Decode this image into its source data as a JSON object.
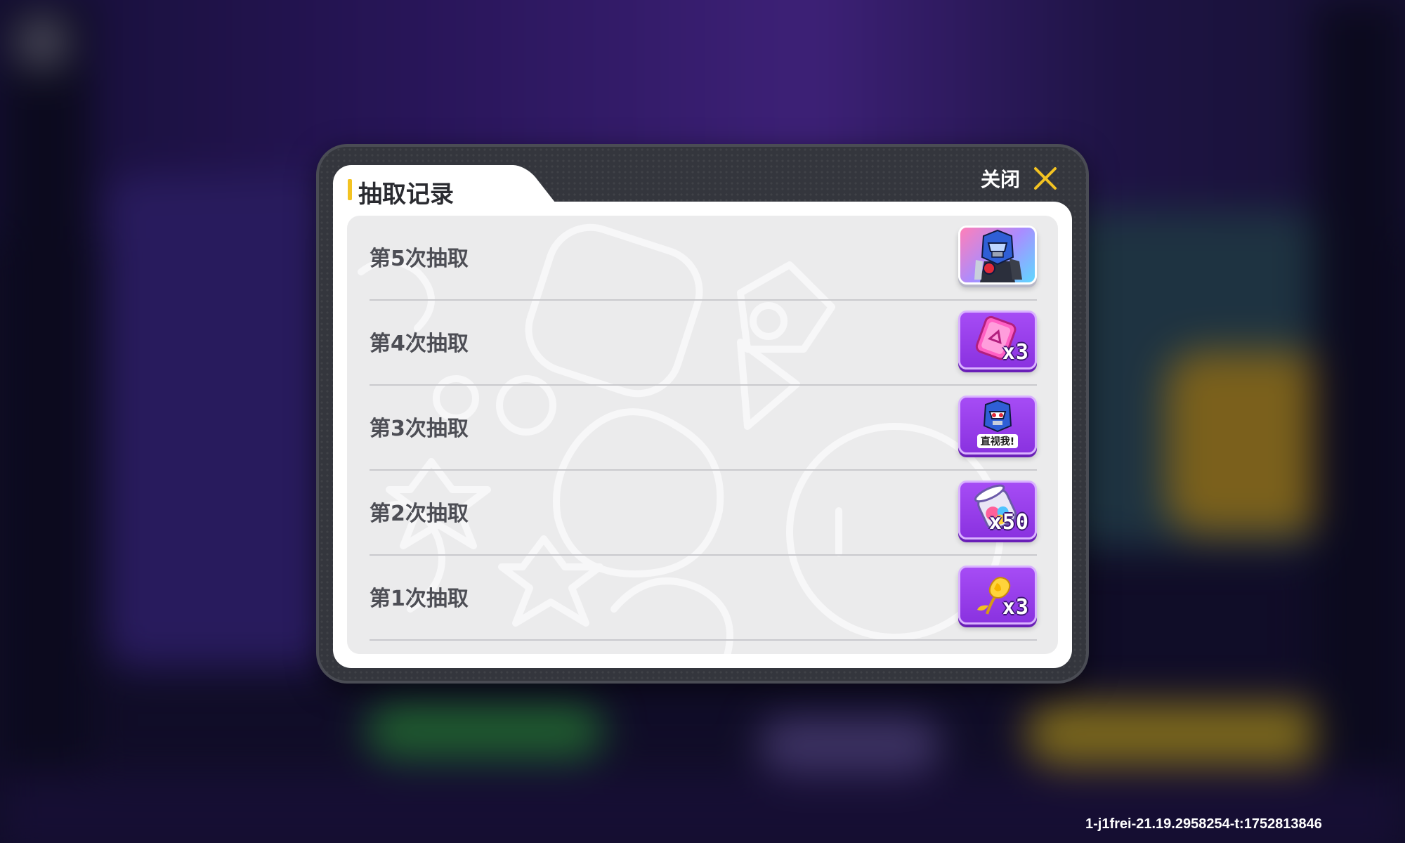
{
  "dialog": {
    "tab_title": "抽取记录",
    "close_label": "关闭"
  },
  "records": [
    {
      "label": "第5次抽取",
      "reward_icon": "hero-robot-portrait-icon",
      "quantity": "",
      "frame": "hero"
    },
    {
      "label": "第4次抽取",
      "reward_icon": "pink-card-icon",
      "quantity": "x3",
      "frame": "purple"
    },
    {
      "label": "第3次抽取",
      "reward_icon": "robot-sticker-icon",
      "quantity": "",
      "sticker_text": "直视我!",
      "frame": "purple"
    },
    {
      "label": "第2次抽取",
      "reward_icon": "gem-jar-icon",
      "quantity": "x50",
      "frame": "purple"
    },
    {
      "label": "第1次抽取",
      "reward_icon": "golden-rose-icon",
      "quantity": "x3",
      "frame": "purple"
    }
  ],
  "version_text": "1-j1frei-21.19.2958254-t:1752813846",
  "colors": {
    "accent": "#f3c322",
    "reward_frame": "#9a40eb",
    "dialog_frame": "#34363d"
  }
}
